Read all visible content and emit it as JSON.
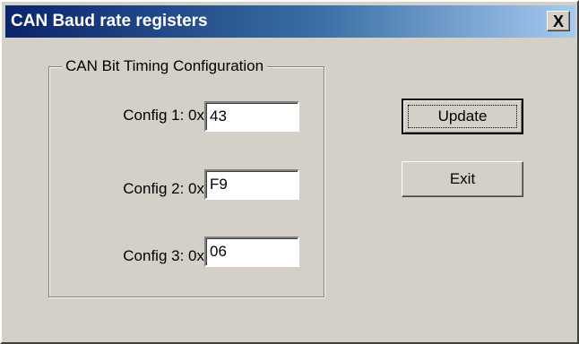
{
  "window": {
    "title": "CAN Baud rate registers",
    "close_label": "X"
  },
  "group": {
    "label": "CAN Bit Timing Configuration",
    "rows": [
      {
        "label": "Config 1: 0x",
        "value": "43"
      },
      {
        "label": "Config 2: 0x",
        "value": "F9"
      },
      {
        "label": "Config 3: 0x",
        "value": "06"
      }
    ]
  },
  "buttons": {
    "update_label": "Update",
    "exit_label": "Exit"
  },
  "colors": {
    "face": "#d4d0c8",
    "title_start": "#0a246a",
    "title_end": "#a6caf0"
  }
}
